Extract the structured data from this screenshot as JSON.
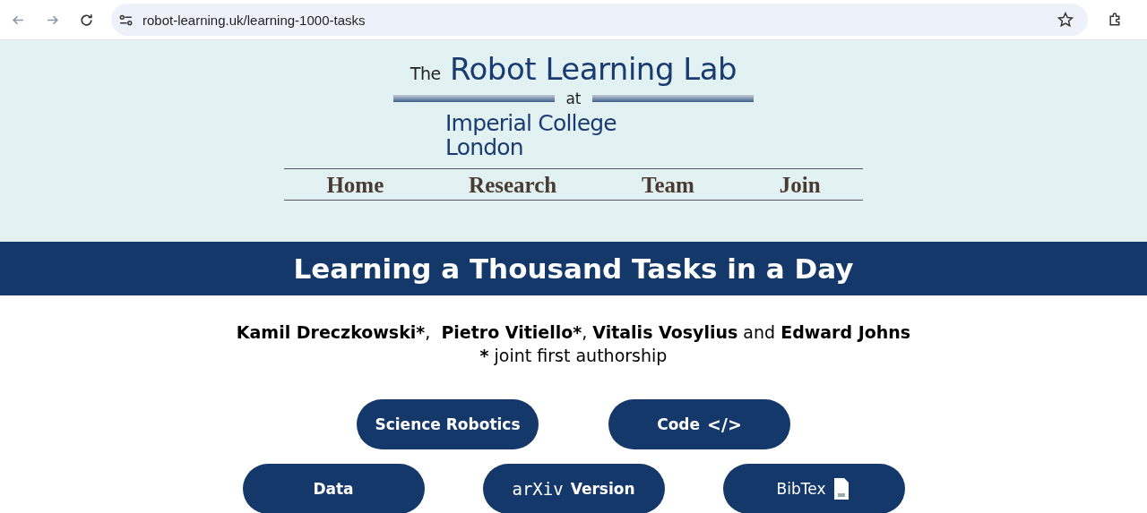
{
  "browser": {
    "url": "robot-learning.uk/learning-1000-tasks"
  },
  "logo": {
    "prefix": "The",
    "name": "Robot Learning Lab",
    "connector": "at",
    "institution_line_1": "Imperial College",
    "institution_line_2": "London"
  },
  "nav": [
    "Home",
    "Research",
    "Team",
    "Join"
  ],
  "title": "Learning a Thousand Tasks in a Day",
  "authors": [
    {
      "name": "Kamil Dreczkowski*",
      "separator": ",  "
    },
    {
      "name": "Pietro Vitiello*",
      "separator": ", "
    },
    {
      "name": "Vitalis Vosylius",
      "separator": " and "
    },
    {
      "name": "Edward Johns"
    }
  ],
  "note": [
    {
      "text": "*",
      "bold": true
    },
    {
      "text": " joint first authorship",
      "bold": false
    }
  ],
  "button_rows": [
    [
      {
        "label": "Science Robotics",
        "kind": "plain"
      },
      {
        "label": "Code",
        "kind": "code",
        "glyph": "</>"
      }
    ],
    [
      {
        "label": "Data",
        "kind": "plain"
      },
      {
        "label": "Version",
        "kind": "arxiv",
        "logo": "arXiv"
      },
      {
        "label": "BibTex",
        "kind": "file"
      }
    ]
  ]
}
